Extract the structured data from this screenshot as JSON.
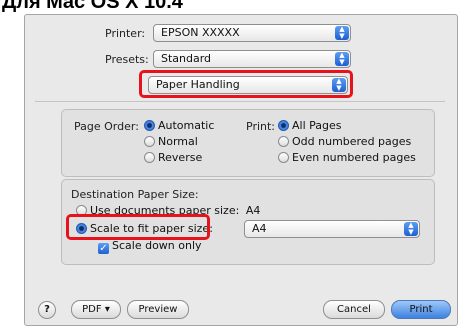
{
  "heading": "Для Mac OS X 10.4",
  "printer": {
    "label": "Printer:",
    "value": "EPSON XXXXX"
  },
  "presets": {
    "label": "Presets:",
    "value": "Standard"
  },
  "panel": {
    "value": "Paper Handling"
  },
  "page_order": {
    "label": "Page Order:",
    "options": [
      "Automatic",
      "Normal",
      "Reverse"
    ],
    "selected": "Automatic"
  },
  "print": {
    "label": "Print:",
    "options": [
      "All Pages",
      "Odd numbered pages",
      "Even numbered pages"
    ],
    "selected": "All Pages"
  },
  "destination": {
    "title": "Destination Paper Size:",
    "use_documents": "Use documents paper size:",
    "use_documents_size": "A4",
    "scale_to_fit": "Scale to fit paper size:",
    "scale_size": "A4",
    "scale_down": "Scale down only",
    "scale_down_checked": true
  },
  "footer": {
    "help": "?",
    "pdf": "PDF ▾",
    "preview": "Preview",
    "cancel": "Cancel",
    "print": "Print"
  }
}
